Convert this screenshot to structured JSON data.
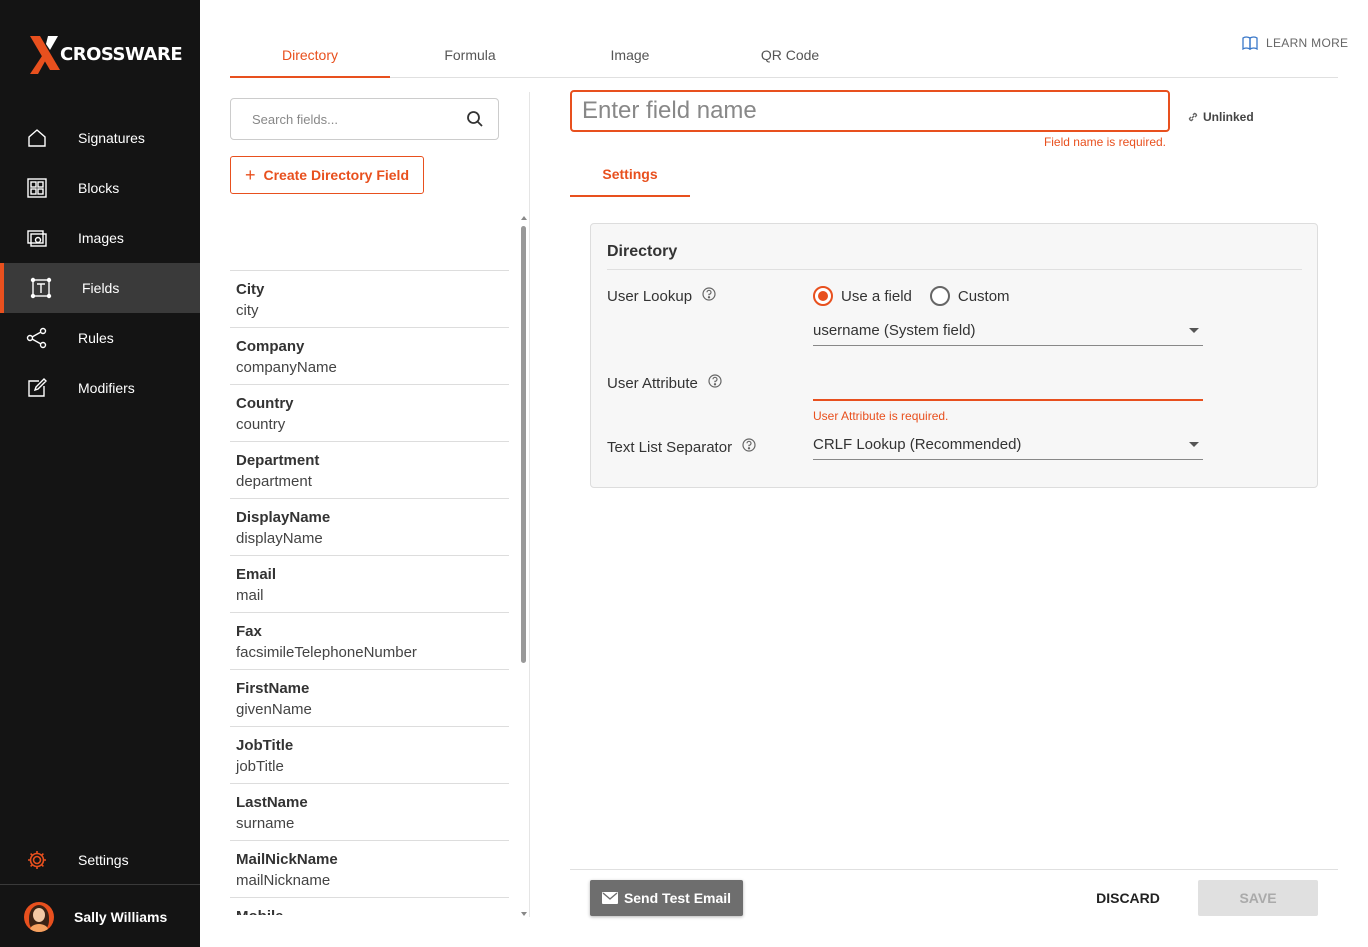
{
  "brand": {
    "name": "CROSSWARE",
    "accent_color": "#e8501e",
    "sidebar_bg": "#141414"
  },
  "sidebar": {
    "items": [
      {
        "label": "Signatures",
        "icon": "home-icon",
        "active": false
      },
      {
        "label": "Blocks",
        "icon": "blocks-icon",
        "active": false
      },
      {
        "label": "Images",
        "icon": "images-icon",
        "active": false
      },
      {
        "label": "Fields",
        "icon": "fields-icon",
        "active": true
      },
      {
        "label": "Rules",
        "icon": "share-icon",
        "active": false
      },
      {
        "label": "Modifiers",
        "icon": "edit-icon",
        "active": false
      }
    ],
    "settings_label": "Settings",
    "user_name": "Sally Williams"
  },
  "tabs": [
    {
      "label": "Directory",
      "active": true
    },
    {
      "label": "Formula",
      "active": false
    },
    {
      "label": "Image",
      "active": false
    },
    {
      "label": "QR Code",
      "active": false
    }
  ],
  "learn_more": "LEARN MORE",
  "left_panel": {
    "search_placeholder": "Search fields...",
    "create_button": "Create Directory Field",
    "fields": [
      {
        "name": "City",
        "attr": "city"
      },
      {
        "name": "Company",
        "attr": "companyName"
      },
      {
        "name": "Country",
        "attr": "country"
      },
      {
        "name": "Department",
        "attr": "department"
      },
      {
        "name": "DisplayName",
        "attr": "displayName"
      },
      {
        "name": "Email",
        "attr": "mail"
      },
      {
        "name": "Fax",
        "attr": "facsimileTelephoneNumber"
      },
      {
        "name": "FirstName",
        "attr": "givenName"
      },
      {
        "name": "JobTitle",
        "attr": "jobTitle"
      },
      {
        "name": "LastName",
        "attr": "surname"
      },
      {
        "name": "MailNickName",
        "attr": "mailNickname"
      },
      {
        "name": "Mobile",
        "attr": ""
      }
    ]
  },
  "editor": {
    "name_placeholder": "Enter field name",
    "name_value": "",
    "name_error": "Field name is required.",
    "link_status": "Unlinked",
    "sub_tab": "Settings",
    "card": {
      "title": "Directory",
      "user_lookup_label": "User Lookup",
      "radio_use_field": "Use a field",
      "radio_custom": "Custom",
      "radio_selected": "Use a field",
      "lookup_select": "username (System field)",
      "user_attribute_label": "User Attribute",
      "user_attribute_value": "",
      "user_attribute_error": "User Attribute is required.",
      "separator_label": "Text List Separator",
      "separator_select": "CRLF Lookup (Recommended)"
    }
  },
  "footer": {
    "send_test": "Send Test Email",
    "discard": "DISCARD",
    "save": "SAVE"
  }
}
